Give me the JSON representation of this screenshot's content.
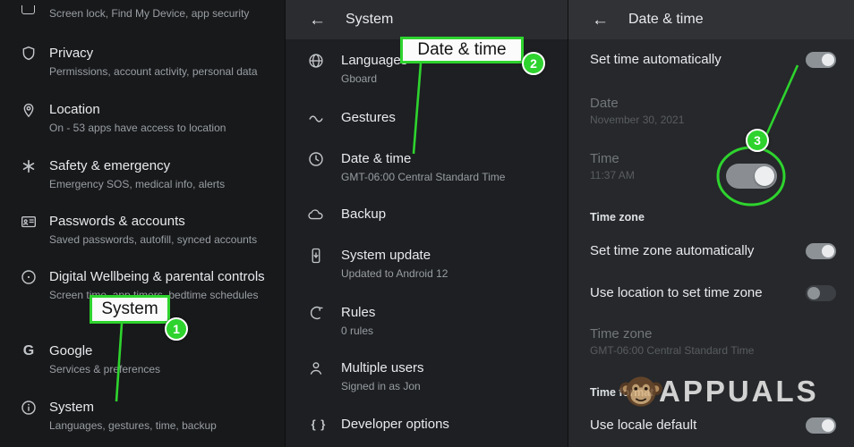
{
  "icons": {
    "back": "←",
    "braces": "{ }",
    "google_letter": "G"
  },
  "annotations": {
    "accent": "#2ed32e",
    "step1_label": "System",
    "step1_badge": "1",
    "step2_label": "Date & time",
    "step2_badge": "2",
    "step3_badge": "3"
  },
  "watermark": {
    "text": "APPUALS"
  },
  "left_panel": {
    "partial_subtitle": "Screen lock, Find My Device, app security",
    "items": [
      {
        "title": "Privacy",
        "subtitle": "Permissions, account activity, personal data"
      },
      {
        "title": "Location",
        "subtitle": "On - 53 apps have access to location"
      },
      {
        "title": "Safety & emergency",
        "subtitle": "Emergency SOS, medical info, alerts"
      },
      {
        "title": "Passwords & accounts",
        "subtitle": "Saved passwords, autofill, synced accounts"
      },
      {
        "title": "Digital Wellbeing & parental controls",
        "subtitle": "Screen time, app timers, bedtime schedules"
      },
      {
        "title": "Google",
        "subtitle": "Services & preferences"
      },
      {
        "title": "System",
        "subtitle": "Languages, gestures, time, backup"
      }
    ]
  },
  "middle_panel": {
    "title": "System",
    "items": [
      {
        "title": "Languages",
        "subtitle": "Gboard"
      },
      {
        "title": "Gestures"
      },
      {
        "title": "Date & time",
        "subtitle": "GMT-06:00 Central Standard Time"
      },
      {
        "title": "Backup"
      },
      {
        "title": "System update",
        "subtitle": "Updated to Android 12"
      },
      {
        "title": "Rules",
        "subtitle": "0 rules"
      },
      {
        "title": "Multiple users",
        "subtitle": "Signed in as Jon"
      },
      {
        "title": "Developer options"
      }
    ]
  },
  "right_panel": {
    "title": "Date & time",
    "rows": [
      {
        "title": "Set time automatically",
        "state": "on"
      },
      {
        "title": "Date",
        "subtitle": "November 30, 2021",
        "disabled": true
      },
      {
        "title": "Time",
        "subtitle": "11:37 AM",
        "disabled": true
      },
      {
        "title": "Time zone",
        "type": "section"
      },
      {
        "title": "Set time zone automatically",
        "state": "on"
      },
      {
        "title": "Use location to set time zone",
        "state": "off"
      },
      {
        "title": "Time zone",
        "subtitle": "GMT-06:00 Central Standard Time",
        "disabled": true
      },
      {
        "title": "Time format",
        "type": "section"
      },
      {
        "title": "Use locale default",
        "state": "on"
      }
    ]
  }
}
